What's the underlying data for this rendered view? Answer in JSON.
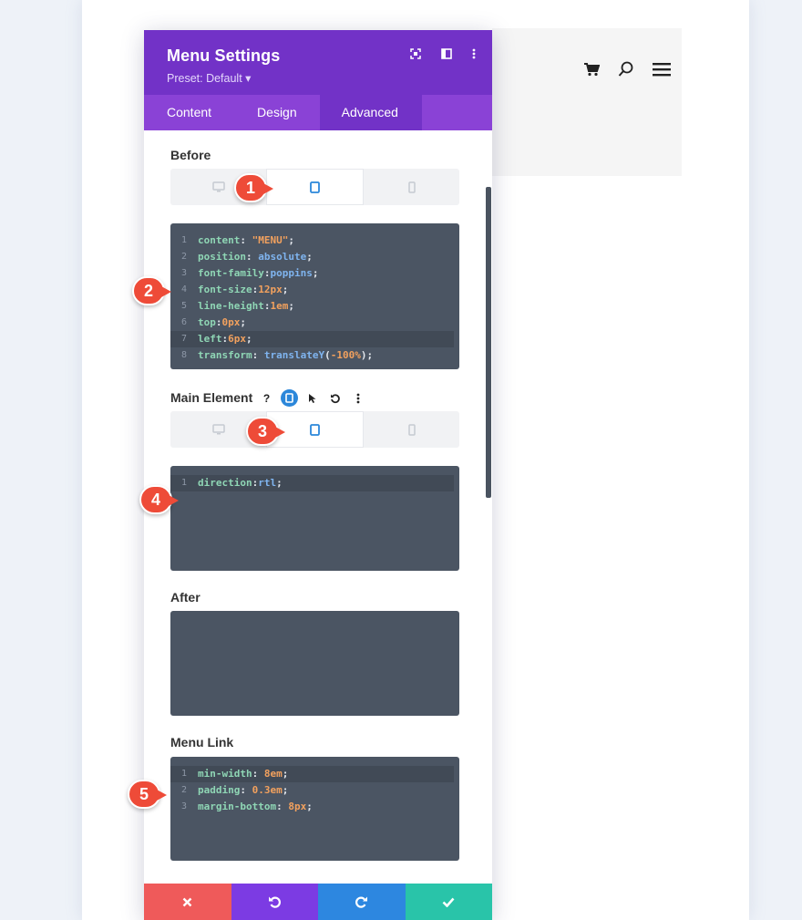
{
  "panel": {
    "title": "Menu Settings",
    "preset": "Preset: Default ▾",
    "tabs": [
      {
        "label": "Content"
      },
      {
        "label": "Design"
      },
      {
        "label": "Advanced"
      }
    ],
    "active_tab": "Advanced"
  },
  "sections": {
    "before": {
      "label": "Before",
      "active_device": "tablet",
      "code": [
        "content: \"MENU\";",
        "position: absolute;",
        "font-family:poppins;",
        "font-size:12px;",
        "line-height:1em;",
        "top:0px;",
        "left:6px;",
        "transform: translateY(-100%);"
      ]
    },
    "main_element": {
      "label": "Main Element",
      "help_icon": "question-icon",
      "active_device": "tablet",
      "code": [
        "direction:rtl;"
      ]
    },
    "after": {
      "label": "After",
      "code": []
    },
    "menu_link": {
      "label": "Menu Link",
      "code": [
        "min-width: 8em;",
        "padding: 0.3em;",
        "margin-bottom: 8px;"
      ]
    }
  },
  "markers": [
    "1",
    "2",
    "3",
    "4",
    "5"
  ],
  "footer": {
    "buttons": [
      {
        "name": "discard",
        "icon": "close-icon",
        "color": "#ef5a5a"
      },
      {
        "name": "undo",
        "icon": "undo-icon",
        "color": "#7c3be3"
      },
      {
        "name": "redo",
        "icon": "redo-icon",
        "color": "#2d87e0"
      },
      {
        "name": "save",
        "icon": "check-icon",
        "color": "#29c4a9"
      }
    ]
  },
  "colors": {
    "header_purple": "#7232c7",
    "tab_purple": "#8a42d6",
    "code_bg": "#4b5563",
    "active_blue": "#2b87da",
    "marker_red": "#ee4b38"
  }
}
